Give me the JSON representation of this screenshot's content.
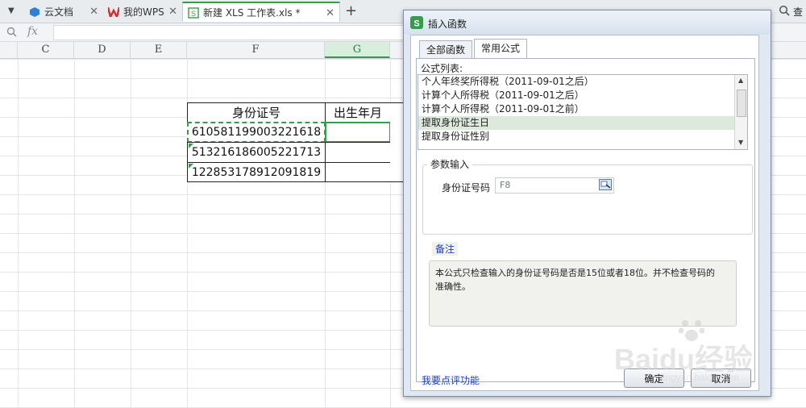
{
  "tabs": [
    {
      "label": "云文档"
    },
    {
      "label": "我的WPS"
    },
    {
      "label": "新建 XLS 工作表.xls *"
    }
  ],
  "formula_bar": {
    "fx_label": "fx",
    "search_char": "查"
  },
  "columns": [
    "C",
    "D",
    "E",
    "F",
    "G"
  ],
  "table": {
    "headers": [
      "身份证号",
      "出生年月"
    ],
    "rows": [
      "610581199003221618",
      "513216186005221713",
      "122853178912091819"
    ]
  },
  "dialog": {
    "title": "插入函数",
    "tabs": [
      "全部函数",
      "常用公式"
    ],
    "list_label": "公式列表:",
    "formulas": [
      "个人年终奖所得税（2011-09-01之后）",
      "计算个人所得税（2011-09-01之后）",
      "计算个人所得税（2011-09-01之前）",
      "提取身份证生日",
      "提取身份证性别"
    ],
    "selected_index": 3,
    "param_group": "参数输入",
    "param_label": "身份证号码",
    "param_value": "F8",
    "note_title": "备注",
    "note_text": "本公式只检查输入的身份证号码是否是15位或者18位。并不检查号码的准确性。",
    "feedback_link": "我要点评功能",
    "ok_label": "确定",
    "cancel_label": "取消"
  },
  "watermark": {
    "text": "Baidu经验",
    "sub": "jingyan.baidu.com"
  },
  "colors": {
    "accent": "#3a9a4b",
    "link": "#1a3fbf"
  }
}
